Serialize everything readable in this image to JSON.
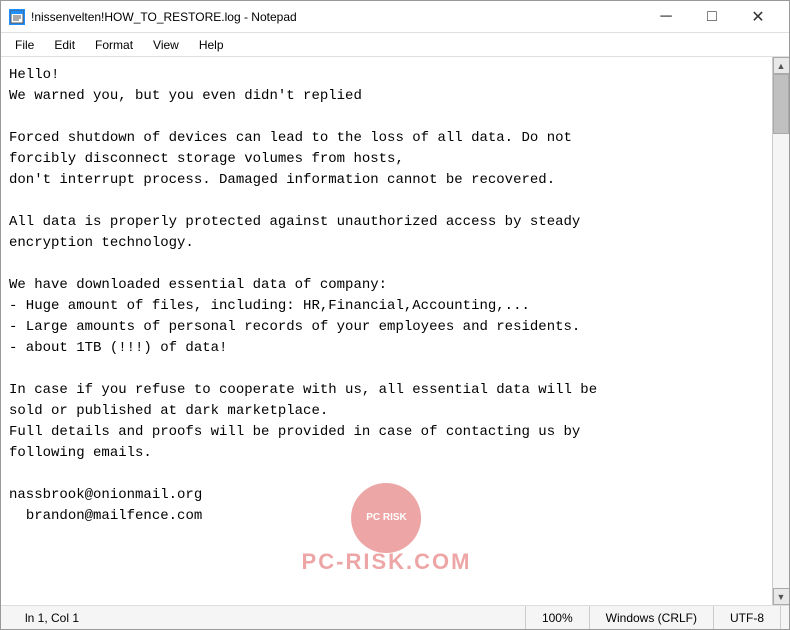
{
  "window": {
    "title": "!nissenvelten!HOW_TO_RESTORE.log - Notepad",
    "icon_label": "notepad-icon"
  },
  "titlebar": {
    "minimize_label": "─",
    "maximize_label": "□",
    "close_label": "✕"
  },
  "menubar": {
    "items": [
      {
        "label": "File",
        "id": "menu-file"
      },
      {
        "label": "Edit",
        "id": "menu-edit"
      },
      {
        "label": "Format",
        "id": "menu-format"
      },
      {
        "label": "View",
        "id": "menu-view"
      },
      {
        "label": "Help",
        "id": "menu-help"
      }
    ]
  },
  "content": {
    "text": "Hello!\nWe warned you, but you even didn't replied\n\nForced shutdown of devices can lead to the loss of all data. Do not\nforcibly disconnect storage volumes from hosts,\ndon't interrupt process. Damaged information cannot be recovered.\n\nAll data is properly protected against unauthorized access by steady\nencryption technology.\n\nWe have downloaded essential data of company:\n- Huge amount of files, including: HR,Financial,Accounting,...\n- Large amounts of personal records of your employees and residents.\n- about 1TB (!!!) of data!\n\nIn case if you refuse to cooperate with us, all essential data will be\nsold or published at dark marketplace.\nFull details and proofs will be provided in case of contacting us by\nfollowing emails.\n\nnassbrook@onionmail.org\n  brandon@mailfence.com"
  },
  "statusbar": {
    "position": "ln 1, Col 1",
    "zoom": "100%",
    "line_ending": "Windows (CRLF)",
    "encoding": "UTF-8"
  },
  "watermark": {
    "circle_text": "PC\nRISK",
    "text": "PC-RISK.COM"
  }
}
